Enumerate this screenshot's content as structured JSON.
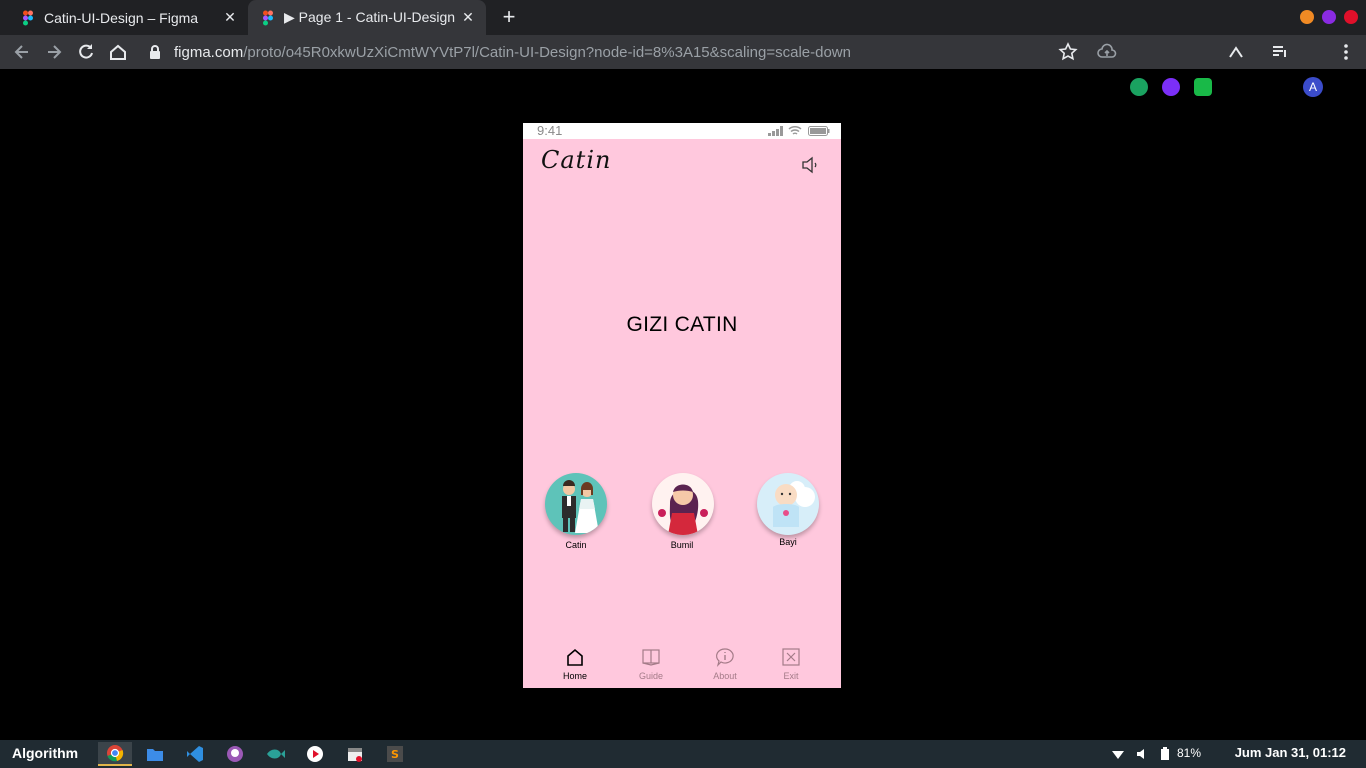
{
  "browser": {
    "tabs": [
      {
        "title": "Catin-UI-Design – Figma",
        "active": false
      },
      {
        "title": "▶ Page 1 - Catin-UI-Design",
        "active": true
      }
    ],
    "url_host": "figma.com",
    "url_path": "/proto/o45R0xkwUzXiCmtWYVtP7l/Catin-UI-Design?node-id=8%3A15&scaling=scale-down",
    "profile_initial": "A",
    "window_colors": [
      "#f08a24",
      "#8a2be2",
      "#e0102a"
    ]
  },
  "phone": {
    "status_time": "9:41",
    "logo": "Catin",
    "title": "GIZI CATIN",
    "background_color": "#ffc8dd",
    "categories": [
      {
        "label": "Catin",
        "icon": "bride-groom-icon"
      },
      {
        "label": "Bumil",
        "icon": "pregnant-woman-icon"
      },
      {
        "label": "Bayi",
        "icon": "baby-icon"
      }
    ],
    "nav": [
      {
        "label": "Home",
        "icon": "home-icon",
        "active": true
      },
      {
        "label": "Guide",
        "icon": "book-icon",
        "active": false
      },
      {
        "label": "About",
        "icon": "info-icon",
        "active": false
      },
      {
        "label": "Exit",
        "icon": "exit-icon",
        "active": false
      }
    ]
  },
  "taskbar": {
    "start_label": "Algorithm",
    "battery": "81%",
    "clock": "Jum Jan 31, 01:12"
  }
}
